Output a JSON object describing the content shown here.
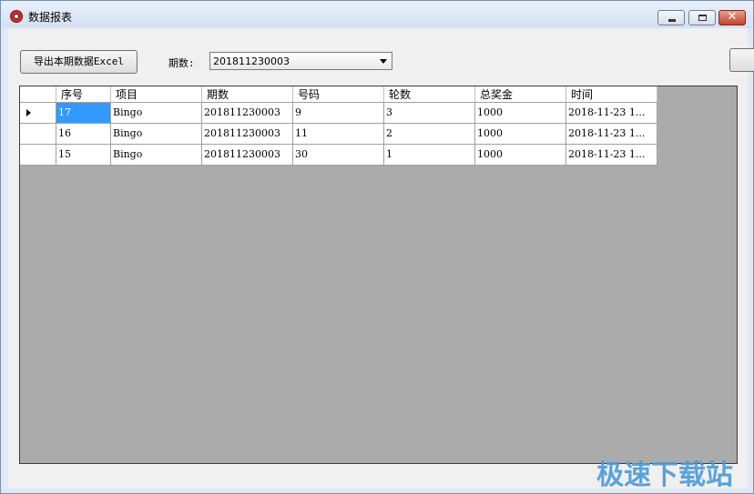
{
  "window": {
    "title": "数据报表"
  },
  "toolbar": {
    "export_label": "导出本期数据Excel",
    "period_label": "期数:",
    "period_value": "201811230003"
  },
  "grid": {
    "columns": [
      "序号",
      "项目",
      "期数",
      "号码",
      "轮数",
      "总奖金",
      "时间"
    ],
    "rows": [
      [
        "17",
        "Bingo",
        "201811230003",
        "9",
        "3",
        "1000",
        "2018-11-23 1..."
      ],
      [
        "16",
        "Bingo",
        "201811230003",
        "11",
        "2",
        "1000",
        "2018-11-23 1..."
      ],
      [
        "15",
        "Bingo",
        "201811230003",
        "30",
        "1",
        "1000",
        "2018-11-23 1..."
      ]
    ]
  },
  "watermark": "极速下载站"
}
